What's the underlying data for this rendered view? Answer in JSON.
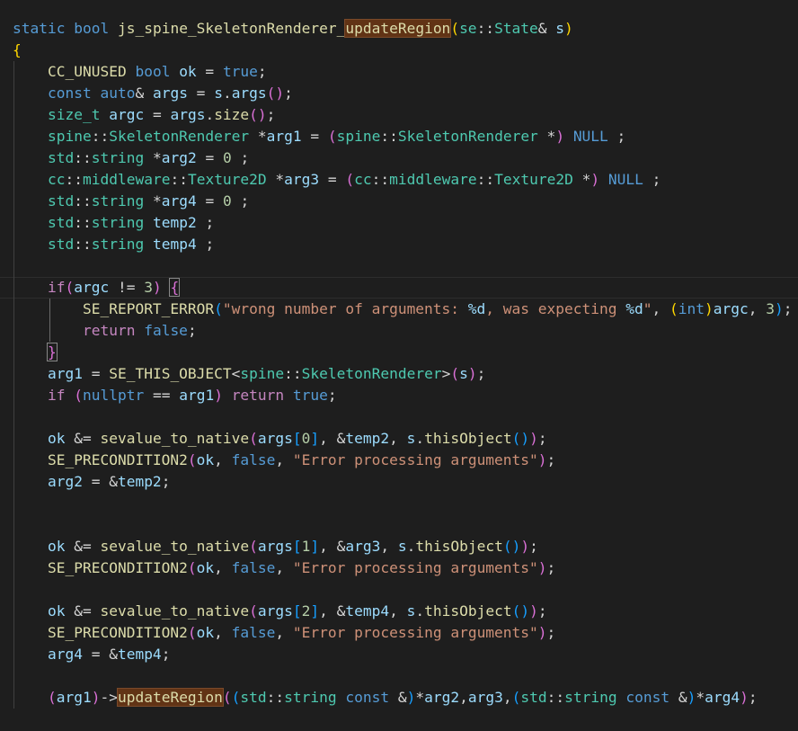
{
  "editor": {
    "language": "cpp",
    "colors": {
      "background": "#1e1e1e",
      "keyword": "#569cd6",
      "control": "#c586c0",
      "function": "#dcdcaa",
      "type": "#4ec9b0",
      "variable": "#9cdcfe",
      "string": "#ce9178",
      "number": "#b5cea8",
      "highlight": "#613315"
    },
    "lines": [
      {
        "indent": 0,
        "tokens": [
          {
            "t": "static",
            "c": "kw"
          },
          {
            "t": " "
          },
          {
            "t": "bool",
            "c": "kw"
          },
          {
            "t": " "
          },
          {
            "t": "js_spine_SkeletonRenderer_",
            "c": "fn"
          },
          {
            "t": "updateRegion",
            "c": "fn hl"
          },
          {
            "t": "(",
            "c": "b1"
          },
          {
            "t": "se",
            "c": "ty"
          },
          {
            "t": "::"
          },
          {
            "t": "State",
            "c": "ty"
          },
          {
            "t": "& "
          },
          {
            "t": "s",
            "c": "var"
          },
          {
            "t": ")",
            "c": "b1"
          }
        ]
      },
      {
        "indent": 0,
        "tokens": [
          {
            "t": "{",
            "c": "b1"
          }
        ]
      },
      {
        "indent": 1,
        "tokens": [
          {
            "t": "CC_UNUSED",
            "c": "mac"
          },
          {
            "t": " "
          },
          {
            "t": "bool",
            "c": "kw"
          },
          {
            "t": " "
          },
          {
            "t": "ok",
            "c": "var"
          },
          {
            "t": " = "
          },
          {
            "t": "true",
            "c": "kw"
          },
          {
            "t": ";"
          }
        ]
      },
      {
        "indent": 1,
        "tokens": [
          {
            "t": "const",
            "c": "kw"
          },
          {
            "t": " "
          },
          {
            "t": "auto",
            "c": "kw"
          },
          {
            "t": "& "
          },
          {
            "t": "args",
            "c": "var"
          },
          {
            "t": " = "
          },
          {
            "t": "s",
            "c": "var"
          },
          {
            "t": "."
          },
          {
            "t": "args",
            "c": "var"
          },
          {
            "t": "()",
            "c": "b2"
          },
          {
            "t": ";"
          }
        ]
      },
      {
        "indent": 1,
        "tokens": [
          {
            "t": "size_t",
            "c": "ty"
          },
          {
            "t": " "
          },
          {
            "t": "argc",
            "c": "var"
          },
          {
            "t": " = "
          },
          {
            "t": "args",
            "c": "var"
          },
          {
            "t": "."
          },
          {
            "t": "size",
            "c": "fn"
          },
          {
            "t": "()",
            "c": "b2"
          },
          {
            "t": ";"
          }
        ]
      },
      {
        "indent": 1,
        "tokens": [
          {
            "t": "spine",
            "c": "ty"
          },
          {
            "t": "::"
          },
          {
            "t": "SkeletonRenderer",
            "c": "ty"
          },
          {
            "t": " *"
          },
          {
            "t": "arg1",
            "c": "var"
          },
          {
            "t": " = "
          },
          {
            "t": "(",
            "c": "b2"
          },
          {
            "t": "spine",
            "c": "ty"
          },
          {
            "t": "::"
          },
          {
            "t": "SkeletonRenderer",
            "c": "ty"
          },
          {
            "t": " *"
          },
          {
            "t": ")",
            "c": "b2"
          },
          {
            "t": " "
          },
          {
            "t": "NULL",
            "c": "kw"
          },
          {
            "t": " ;"
          }
        ]
      },
      {
        "indent": 1,
        "tokens": [
          {
            "t": "std",
            "c": "ty"
          },
          {
            "t": "::"
          },
          {
            "t": "string",
            "c": "ty"
          },
          {
            "t": " *"
          },
          {
            "t": "arg2",
            "c": "var"
          },
          {
            "t": " = "
          },
          {
            "t": "0",
            "c": "num"
          },
          {
            "t": " ;"
          }
        ]
      },
      {
        "indent": 1,
        "tokens": [
          {
            "t": "cc",
            "c": "ty"
          },
          {
            "t": "::"
          },
          {
            "t": "middleware",
            "c": "ty"
          },
          {
            "t": "::"
          },
          {
            "t": "Texture2D",
            "c": "ty"
          },
          {
            "t": " *"
          },
          {
            "t": "arg3",
            "c": "var"
          },
          {
            "t": " = "
          },
          {
            "t": "(",
            "c": "b2"
          },
          {
            "t": "cc",
            "c": "ty"
          },
          {
            "t": "::"
          },
          {
            "t": "middleware",
            "c": "ty"
          },
          {
            "t": "::"
          },
          {
            "t": "Texture2D",
            "c": "ty"
          },
          {
            "t": " *"
          },
          {
            "t": ")",
            "c": "b2"
          },
          {
            "t": " "
          },
          {
            "t": "NULL",
            "c": "kw"
          },
          {
            "t": " ;"
          }
        ]
      },
      {
        "indent": 1,
        "tokens": [
          {
            "t": "std",
            "c": "ty"
          },
          {
            "t": "::"
          },
          {
            "t": "string",
            "c": "ty"
          },
          {
            "t": " *"
          },
          {
            "t": "arg4",
            "c": "var"
          },
          {
            "t": " = "
          },
          {
            "t": "0",
            "c": "num"
          },
          {
            "t": " ;"
          }
        ]
      },
      {
        "indent": 1,
        "tokens": [
          {
            "t": "std",
            "c": "ty"
          },
          {
            "t": "::"
          },
          {
            "t": "string",
            "c": "ty"
          },
          {
            "t": " "
          },
          {
            "t": "temp2",
            "c": "var"
          },
          {
            "t": " ;"
          }
        ]
      },
      {
        "indent": 1,
        "tokens": [
          {
            "t": "std",
            "c": "ty"
          },
          {
            "t": "::"
          },
          {
            "t": "string",
            "c": "ty"
          },
          {
            "t": " "
          },
          {
            "t": "temp4",
            "c": "var"
          },
          {
            "t": " ;"
          }
        ]
      },
      {
        "indent": 1,
        "tokens": []
      },
      {
        "indent": 1,
        "active": true,
        "tokens": [
          {
            "t": "if",
            "c": "ctl"
          },
          {
            "t": "(",
            "c": "b2"
          },
          {
            "t": "argc",
            "c": "var"
          },
          {
            "t": " != "
          },
          {
            "t": "3",
            "c": "num"
          },
          {
            "t": ")",
            "c": "b2"
          },
          {
            "t": " "
          },
          {
            "t": "{",
            "c": "b2 bm"
          }
        ]
      },
      {
        "indent": 2,
        "tokens": [
          {
            "t": "SE_REPORT_ERROR",
            "c": "mac"
          },
          {
            "t": "(",
            "c": "b3"
          },
          {
            "t": "\"wrong number of arguments: ",
            "c": "str"
          },
          {
            "t": "%d",
            "c": "var"
          },
          {
            "t": ", was expecting ",
            "c": "str"
          },
          {
            "t": "%d",
            "c": "var"
          },
          {
            "t": "\"",
            "c": "str"
          },
          {
            "t": ", "
          },
          {
            "t": "(",
            "c": "b1"
          },
          {
            "t": "int",
            "c": "kw"
          },
          {
            "t": ")",
            "c": "b1"
          },
          {
            "t": "argc",
            "c": "var"
          },
          {
            "t": ", "
          },
          {
            "t": "3",
            "c": "num"
          },
          {
            "t": ")",
            "c": "b3"
          },
          {
            "t": ";"
          }
        ]
      },
      {
        "indent": 2,
        "tokens": [
          {
            "t": "return",
            "c": "ctl"
          },
          {
            "t": " "
          },
          {
            "t": "false",
            "c": "kw"
          },
          {
            "t": ";"
          }
        ]
      },
      {
        "indent": 1,
        "tokens": [
          {
            "t": "}",
            "c": "b2 bm"
          }
        ]
      },
      {
        "indent": 1,
        "tokens": [
          {
            "t": "arg1",
            "c": "var"
          },
          {
            "t": " = "
          },
          {
            "t": "SE_THIS_OBJECT",
            "c": "mac"
          },
          {
            "t": "<"
          },
          {
            "t": "spine",
            "c": "ty"
          },
          {
            "t": "::"
          },
          {
            "t": "SkeletonRenderer",
            "c": "ty"
          },
          {
            "t": ">"
          },
          {
            "t": "(",
            "c": "b2"
          },
          {
            "t": "s",
            "c": "var"
          },
          {
            "t": ")",
            "c": "b2"
          },
          {
            "t": ";"
          }
        ]
      },
      {
        "indent": 1,
        "tokens": [
          {
            "t": "if",
            "c": "ctl"
          },
          {
            "t": " "
          },
          {
            "t": "(",
            "c": "b2"
          },
          {
            "t": "nullptr",
            "c": "kw"
          },
          {
            "t": " == "
          },
          {
            "t": "arg1",
            "c": "var"
          },
          {
            "t": ")",
            "c": "b2"
          },
          {
            "t": " "
          },
          {
            "t": "return",
            "c": "ctl"
          },
          {
            "t": " "
          },
          {
            "t": "true",
            "c": "kw"
          },
          {
            "t": ";"
          }
        ]
      },
      {
        "indent": 1,
        "tokens": []
      },
      {
        "indent": 1,
        "tokens": [
          {
            "t": "ok",
            "c": "var"
          },
          {
            "t": " &= "
          },
          {
            "t": "sevalue_to_native",
            "c": "fn"
          },
          {
            "t": "(",
            "c": "b2"
          },
          {
            "t": "args",
            "c": "var"
          },
          {
            "t": "[",
            "c": "b3"
          },
          {
            "t": "0",
            "c": "num"
          },
          {
            "t": "]",
            "c": "b3"
          },
          {
            "t": ", &"
          },
          {
            "t": "temp2",
            "c": "var"
          },
          {
            "t": ", "
          },
          {
            "t": "s",
            "c": "var"
          },
          {
            "t": "."
          },
          {
            "t": "thisObject",
            "c": "fn"
          },
          {
            "t": "()",
            "c": "b3"
          },
          {
            "t": ")",
            "c": "b2"
          },
          {
            "t": ";"
          }
        ]
      },
      {
        "indent": 1,
        "tokens": [
          {
            "t": "SE_PRECONDITION2",
            "c": "mac"
          },
          {
            "t": "(",
            "c": "b2"
          },
          {
            "t": "ok",
            "c": "var"
          },
          {
            "t": ", "
          },
          {
            "t": "false",
            "c": "kw"
          },
          {
            "t": ", "
          },
          {
            "t": "\"Error processing arguments\"",
            "c": "str"
          },
          {
            "t": ")",
            "c": "b2"
          },
          {
            "t": ";"
          }
        ]
      },
      {
        "indent": 1,
        "tokens": [
          {
            "t": "arg2",
            "c": "var"
          },
          {
            "t": " = &"
          },
          {
            "t": "temp2",
            "c": "var"
          },
          {
            "t": ";"
          }
        ]
      },
      {
        "indent": 1,
        "tokens": []
      },
      {
        "indent": 1,
        "tokens": []
      },
      {
        "indent": 1,
        "tokens": [
          {
            "t": "ok",
            "c": "var"
          },
          {
            "t": " &= "
          },
          {
            "t": "sevalue_to_native",
            "c": "fn"
          },
          {
            "t": "(",
            "c": "b2"
          },
          {
            "t": "args",
            "c": "var"
          },
          {
            "t": "[",
            "c": "b3"
          },
          {
            "t": "1",
            "c": "num"
          },
          {
            "t": "]",
            "c": "b3"
          },
          {
            "t": ", &"
          },
          {
            "t": "arg3",
            "c": "var"
          },
          {
            "t": ", "
          },
          {
            "t": "s",
            "c": "var"
          },
          {
            "t": "."
          },
          {
            "t": "thisObject",
            "c": "fn"
          },
          {
            "t": "()",
            "c": "b3"
          },
          {
            "t": ")",
            "c": "b2"
          },
          {
            "t": ";"
          }
        ]
      },
      {
        "indent": 1,
        "tokens": [
          {
            "t": "SE_PRECONDITION2",
            "c": "mac"
          },
          {
            "t": "(",
            "c": "b2"
          },
          {
            "t": "ok",
            "c": "var"
          },
          {
            "t": ", "
          },
          {
            "t": "false",
            "c": "kw"
          },
          {
            "t": ", "
          },
          {
            "t": "\"Error processing arguments\"",
            "c": "str"
          },
          {
            "t": ")",
            "c": "b2"
          },
          {
            "t": ";"
          }
        ]
      },
      {
        "indent": 1,
        "tokens": []
      },
      {
        "indent": 1,
        "tokens": [
          {
            "t": "ok",
            "c": "var"
          },
          {
            "t": " &= "
          },
          {
            "t": "sevalue_to_native",
            "c": "fn"
          },
          {
            "t": "(",
            "c": "b2"
          },
          {
            "t": "args",
            "c": "var"
          },
          {
            "t": "[",
            "c": "b3"
          },
          {
            "t": "2",
            "c": "num"
          },
          {
            "t": "]",
            "c": "b3"
          },
          {
            "t": ", &"
          },
          {
            "t": "temp4",
            "c": "var"
          },
          {
            "t": ", "
          },
          {
            "t": "s",
            "c": "var"
          },
          {
            "t": "."
          },
          {
            "t": "thisObject",
            "c": "fn"
          },
          {
            "t": "()",
            "c": "b3"
          },
          {
            "t": ")",
            "c": "b2"
          },
          {
            "t": ";"
          }
        ]
      },
      {
        "indent": 1,
        "tokens": [
          {
            "t": "SE_PRECONDITION2",
            "c": "mac"
          },
          {
            "t": "(",
            "c": "b2"
          },
          {
            "t": "ok",
            "c": "var"
          },
          {
            "t": ", "
          },
          {
            "t": "false",
            "c": "kw"
          },
          {
            "t": ", "
          },
          {
            "t": "\"Error processing arguments\"",
            "c": "str"
          },
          {
            "t": ")",
            "c": "b2"
          },
          {
            "t": ";"
          }
        ]
      },
      {
        "indent": 1,
        "tokens": [
          {
            "t": "arg4",
            "c": "var"
          },
          {
            "t": " = &"
          },
          {
            "t": "temp4",
            "c": "var"
          },
          {
            "t": ";"
          }
        ]
      },
      {
        "indent": 1,
        "tokens": []
      },
      {
        "indent": 1,
        "tokens": [
          {
            "t": "(",
            "c": "b2"
          },
          {
            "t": "arg1",
            "c": "var"
          },
          {
            "t": ")",
            "c": "b2"
          },
          {
            "t": "->"
          },
          {
            "t": "updateRegion",
            "c": "fn hl"
          },
          {
            "t": "(",
            "c": "b2"
          },
          {
            "t": "(",
            "c": "b3"
          },
          {
            "t": "std",
            "c": "ty"
          },
          {
            "t": "::"
          },
          {
            "t": "string",
            "c": "ty"
          },
          {
            "t": " "
          },
          {
            "t": "const",
            "c": "kw"
          },
          {
            "t": " &"
          },
          {
            "t": ")",
            "c": "b3"
          },
          {
            "t": "*"
          },
          {
            "t": "arg2",
            "c": "var"
          },
          {
            "t": ","
          },
          {
            "t": "arg3",
            "c": "var"
          },
          {
            "t": ","
          },
          {
            "t": "(",
            "c": "b3"
          },
          {
            "t": "std",
            "c": "ty"
          },
          {
            "t": "::"
          },
          {
            "t": "string",
            "c": "ty"
          },
          {
            "t": " "
          },
          {
            "t": "const",
            "c": "kw"
          },
          {
            "t": " &"
          },
          {
            "t": ")",
            "c": "b3"
          },
          {
            "t": "*"
          },
          {
            "t": "arg4",
            "c": "var"
          },
          {
            "t": ")",
            "c": "b2"
          },
          {
            "t": ";"
          }
        ]
      }
    ]
  }
}
